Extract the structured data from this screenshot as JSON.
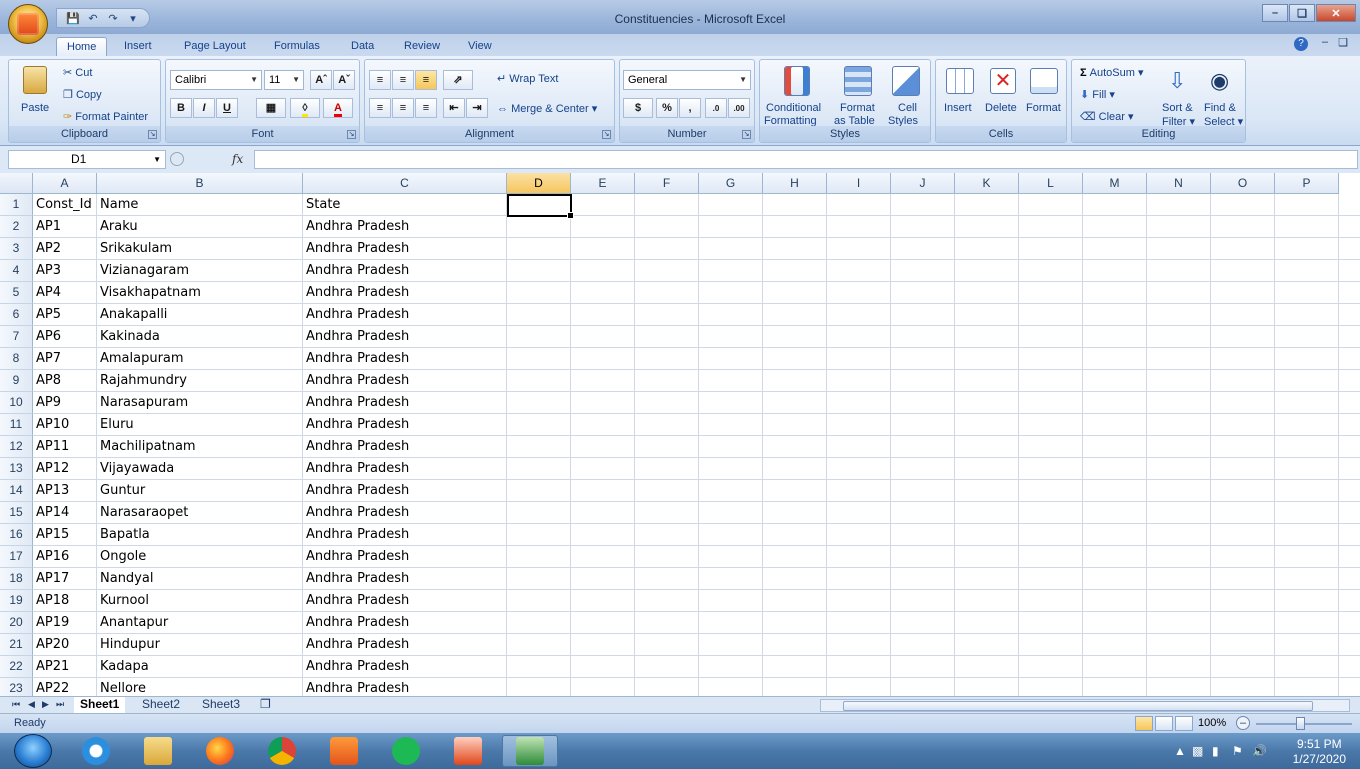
{
  "window": {
    "title": "Constituencies - Microsoft Excel"
  },
  "tabs": [
    "Home",
    "Insert",
    "Page Layout",
    "Formulas",
    "Data",
    "Review",
    "View"
  ],
  "clipboard": {
    "paste": "Paste",
    "cut": "Cut",
    "copy": "Copy",
    "format_painter": "Format Painter",
    "label": "Clipboard"
  },
  "font": {
    "name": "Calibri",
    "size": "11",
    "label": "Font",
    "bold": "B",
    "italic": "I",
    "underline": "U"
  },
  "alignment": {
    "wrap": "Wrap Text",
    "merge": "Merge & Center",
    "label": "Alignment"
  },
  "number": {
    "format": "General",
    "currency": "$",
    "percent": "%",
    "comma": ",",
    "label": "Number"
  },
  "styles": {
    "conditional": "Conditional",
    "formatting": "Formatting",
    "format": "Format",
    "as_table": "as Table",
    "cell": "Cell",
    "cell_styles": "Styles",
    "label": "Styles"
  },
  "cells": {
    "insert": "Insert",
    "delete": "Delete",
    "format": "Format",
    "label": "Cells"
  },
  "editing": {
    "autosum": "AutoSum",
    "fill": "Fill",
    "clear": "Clear",
    "sort": "Sort &",
    "filter": "Filter",
    "find": "Find &",
    "select": "Select",
    "label": "Editing"
  },
  "formula_bar": {
    "name_box": "D1",
    "fx": "fx",
    "value": ""
  },
  "columns": [
    "A",
    "B",
    "C",
    "D",
    "E",
    "F",
    "G",
    "H",
    "I",
    "J",
    "K",
    "L",
    "M",
    "N",
    "O",
    "P"
  ],
  "selected_column": "D",
  "rows": [
    [
      "Const_Id",
      "Name",
      "State"
    ],
    [
      "AP1",
      "Araku",
      "Andhra Pradesh"
    ],
    [
      "AP2",
      "Srikakulam",
      "Andhra Pradesh"
    ],
    [
      "AP3",
      "Vizianagaram",
      "Andhra Pradesh"
    ],
    [
      "AP4",
      "Visakhapatnam",
      "Andhra Pradesh"
    ],
    [
      "AP5",
      "Anakapalli",
      "Andhra Pradesh"
    ],
    [
      "AP6",
      "Kakinada",
      "Andhra Pradesh"
    ],
    [
      "AP7",
      "Amalapuram",
      "Andhra Pradesh"
    ],
    [
      "AP8",
      "Rajahmundry",
      "Andhra Pradesh"
    ],
    [
      "AP9",
      "Narasapuram",
      "Andhra Pradesh"
    ],
    [
      "AP10",
      "Eluru",
      "Andhra Pradesh"
    ],
    [
      "AP11",
      "Machilipatnam",
      "Andhra Pradesh"
    ],
    [
      "AP12",
      "Vijayawada",
      "Andhra Pradesh"
    ],
    [
      "AP13",
      "Guntur",
      "Andhra Pradesh"
    ],
    [
      "AP14",
      "Narasaraopet",
      "Andhra Pradesh"
    ],
    [
      "AP15",
      "Bapatla",
      "Andhra Pradesh"
    ],
    [
      "AP16",
      "Ongole",
      "Andhra Pradesh"
    ],
    [
      "AP17",
      "Nandyal",
      "Andhra Pradesh"
    ],
    [
      "AP18",
      "Kurnool",
      "Andhra Pradesh"
    ],
    [
      "AP19",
      "Anantapur",
      "Andhra Pradesh"
    ],
    [
      "AP20",
      "Hindupur",
      "Andhra Pradesh"
    ],
    [
      "AP21",
      "Kadapa",
      "Andhra Pradesh"
    ],
    [
      "AP22",
      "Nellore",
      "Andhra Pradesh"
    ]
  ],
  "sheets": [
    "Sheet1",
    "Sheet2",
    "Sheet3"
  ],
  "active_sheet": "Sheet1",
  "status": {
    "text": "Ready",
    "zoom": "100%"
  },
  "taskbar": {
    "time": "9:51 PM",
    "date": "1/27/2020"
  }
}
